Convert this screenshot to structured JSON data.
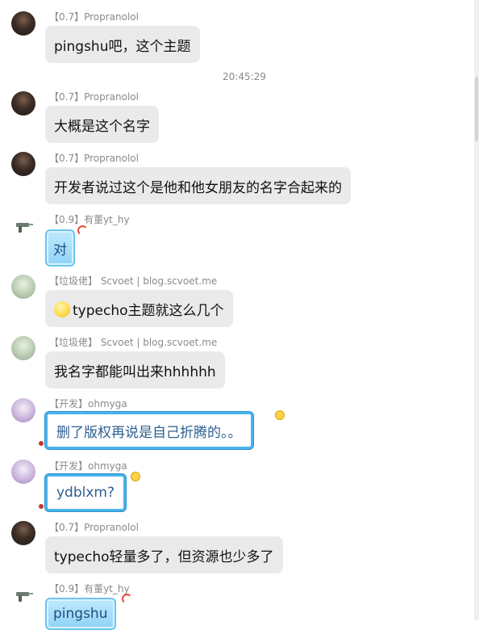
{
  "chat": {
    "timestamp": "20:45:29",
    "messages": [
      {
        "sender": "【0.7】Propranolol",
        "text": "pingshu吧，这个主题"
      },
      {
        "sender": "【0.7】Propranolol",
        "text": "大概是这个名字"
      },
      {
        "sender": "【0.7】Propranolol",
        "text": "开发者说过这个是他和他女朋友的名字合起来的"
      },
      {
        "sender": "【0.9】有董yt_hy",
        "text": "对"
      },
      {
        "sender": "【垃圾佬】 Scvoet | blog.scvoet.me",
        "text": "typecho主题就这么几个",
        "emoji": "smiley-icon"
      },
      {
        "sender": "【垃圾佬】 Scvoet | blog.scvoet.me",
        "text": "我名字都能叫出来hhhhhh"
      },
      {
        "sender": "【开发】ohmyga",
        "text": "删了版权再说是自己折腾的。。"
      },
      {
        "sender": "【开发】ohmyga",
        "text": "ydblxm?"
      },
      {
        "sender": "【0.7】Propranolol",
        "text": "typecho轻量多了，但资源也少多了"
      },
      {
        "sender": "【0.9】有董yt_hy",
        "text": "pingshu"
      }
    ]
  }
}
